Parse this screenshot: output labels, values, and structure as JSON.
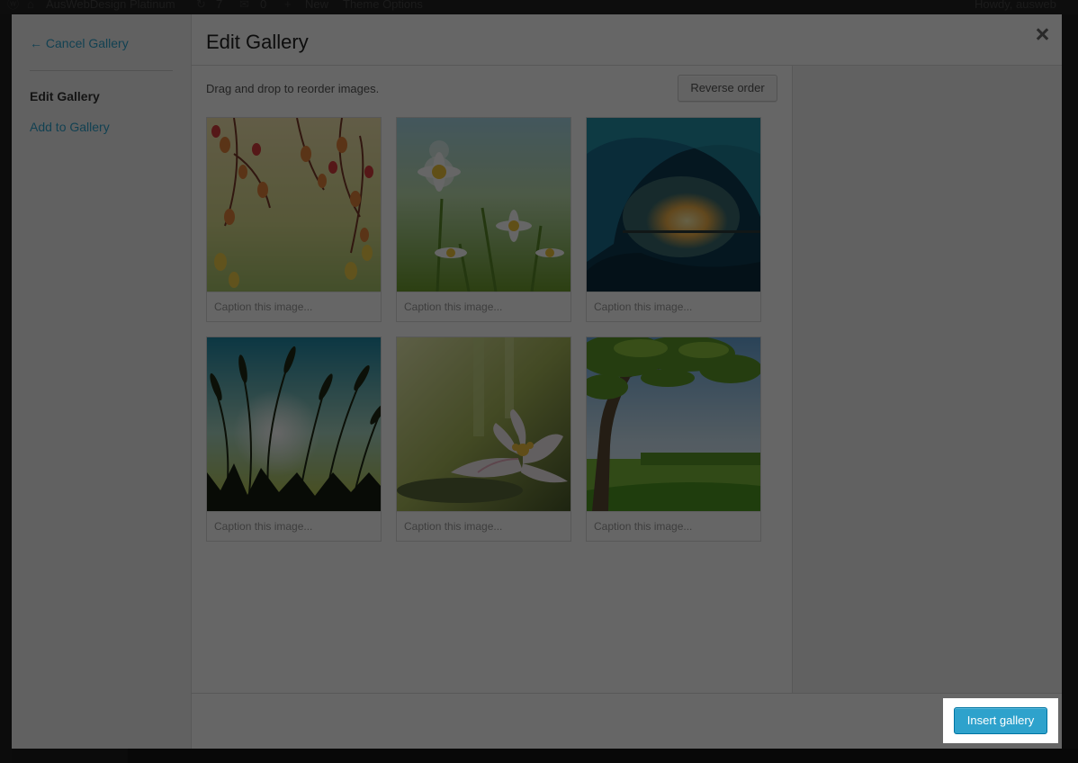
{
  "admin_bar": {
    "site_name": "AusWebDesign Platinum",
    "updates_count": "7",
    "comments_count": "0",
    "new_label": "New",
    "theme_options_label": "Theme Options",
    "greeting": "Howdy, ausweb"
  },
  "menu": {
    "cancel_label": "← Cancel Gallery",
    "active_item": "Edit Gallery",
    "add_item": "Add to Gallery"
  },
  "header": {
    "title": "Edit Gallery"
  },
  "content": {
    "instructions": "Drag and drop to reorder images.",
    "reverse_label": "Reverse order",
    "caption_placeholder": "Caption this image...",
    "images": [
      {
        "subject": "autumn-leaves"
      },
      {
        "subject": "daisies"
      },
      {
        "subject": "ocean-wave-sunset"
      },
      {
        "subject": "reeds-sky"
      },
      {
        "subject": "water-lily"
      },
      {
        "subject": "tree-meadow"
      }
    ]
  },
  "toolbar": {
    "insert_label": "Insert gallery"
  },
  "colors": {
    "accent": "#2ea2cc",
    "overlay": "rgba(0,0,0,0.60)"
  }
}
